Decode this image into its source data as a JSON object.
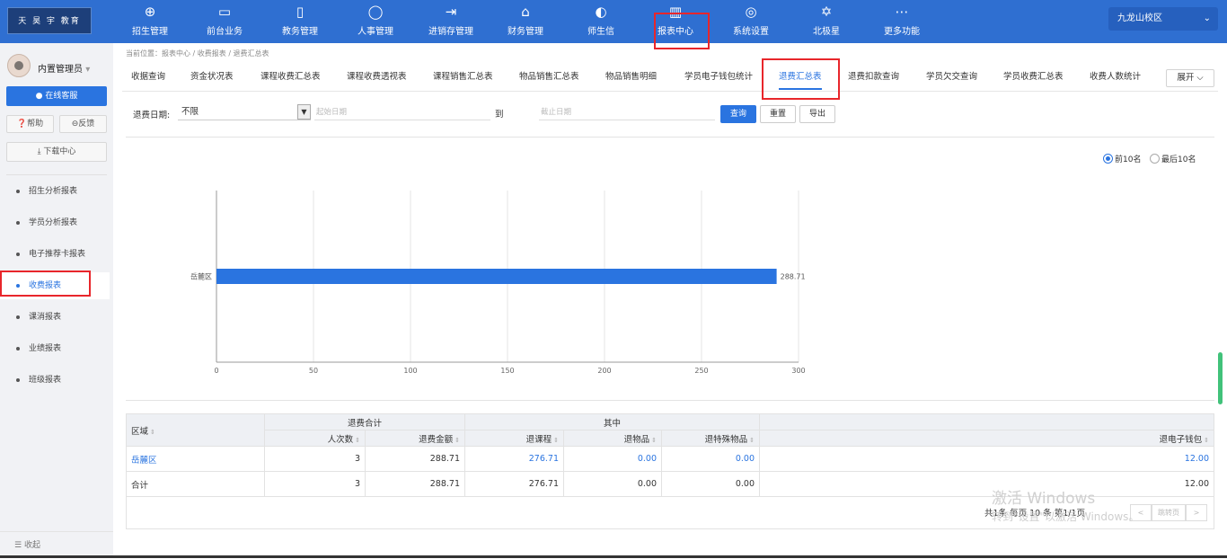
{
  "header": {
    "logo_text": "天 昊 宇 教育",
    "nav": [
      {
        "label": "招生管理",
        "icon": "person-add-icon",
        "glyph": "⊕"
      },
      {
        "label": "前台业务",
        "icon": "monitor-icon",
        "glyph": "▭"
      },
      {
        "label": "教务管理",
        "icon": "book-icon",
        "glyph": "▯"
      },
      {
        "label": "人事管理",
        "icon": "user-icon",
        "glyph": "◯"
      },
      {
        "label": "进销存管理",
        "icon": "arrow-in-icon",
        "glyph": "⇥"
      },
      {
        "label": "财务管理",
        "icon": "money-house-icon",
        "glyph": "⌂"
      },
      {
        "label": "师生信",
        "icon": "message-circle-icon",
        "glyph": "◐"
      },
      {
        "label": "报表中心",
        "icon": "bar-chart-icon",
        "glyph": "▥"
      },
      {
        "label": "系统设置",
        "icon": "settings-icon",
        "glyph": "◎"
      },
      {
        "label": "北极星",
        "icon": "star-icon",
        "glyph": "✡"
      },
      {
        "label": "更多功能",
        "icon": "more-icon",
        "glyph": "⋯"
      }
    ],
    "campus": "九龙山校区",
    "campus_chevron": "⌄"
  },
  "sidebar": {
    "user_name": "内置管理员",
    "user_chevron": "▾",
    "service_btn": "在线客服",
    "help_btn": "帮助",
    "feedback_btn": "反馈",
    "download_btn": "下载中心",
    "items": [
      {
        "label": "招生分析报表"
      },
      {
        "label": "学员分析报表"
      },
      {
        "label": "电子推荐卡报表"
      },
      {
        "label": "收费报表"
      },
      {
        "label": "课消报表"
      },
      {
        "label": "业绩报表"
      },
      {
        "label": "班级报表"
      }
    ],
    "collapse": "收起"
  },
  "breadcrumb": "当前位置：报表中心 / 收费报表 / 退费汇总表",
  "tabs": [
    "收据查询",
    "资金状况表",
    "课程收费汇总表",
    "课程收费透视表",
    "课程销售汇总表",
    "物品销售汇总表",
    "物品销售明细",
    "学员电子钱包统计",
    "退费汇总表",
    "退费扣款查询",
    "学员欠交查询",
    "学员收费汇总表",
    "收费人数统计"
  ],
  "expand": "展开 ⌵",
  "filter": {
    "label": "退费日期:",
    "select_value": "不限",
    "select_arrow": "▼",
    "start_placeholder": "起始日期",
    "to": "到",
    "end_placeholder": "截止日期",
    "query": "查询",
    "reset": "重置",
    "export": "导出"
  },
  "radios": {
    "top10": "前10名",
    "bottom10": "最后10名"
  },
  "chart_data": {
    "type": "bar",
    "orientation": "horizontal",
    "categories": [
      "岳麓区"
    ],
    "values": [
      288.71
    ],
    "value_labels": [
      "288.71"
    ],
    "xlim": [
      0,
      300
    ],
    "xticks": [
      0,
      50,
      100,
      150,
      200,
      250,
      300
    ],
    "grid": true,
    "color": "#2a74e0"
  },
  "table": {
    "col_region": "区域",
    "group_refund_total": "退费合计",
    "group_detail": "其中",
    "cols": [
      "人次数",
      "退费金额",
      "退课程",
      "退物品",
      "退特殊物品",
      "退电子钱包"
    ],
    "rows": [
      {
        "region": "岳麓区",
        "count": "3",
        "amount": "288.71",
        "course": "276.71",
        "goods": "0.00",
        "special": "0.00",
        "wallet": "12.00"
      },
      {
        "region": "合计",
        "count": "3",
        "amount": "288.71",
        "course": "276.71",
        "goods": "0.00",
        "special": "0.00",
        "wallet": "12.00"
      }
    ]
  },
  "pager": {
    "text": "共1条  每页  10  条  第1/1页",
    "prev": "<",
    "goto": "跳转页",
    "next": ">"
  },
  "watermark": {
    "line1": "激活 Windows",
    "line2": "转到\"设置\"以激活 Windows。"
  }
}
